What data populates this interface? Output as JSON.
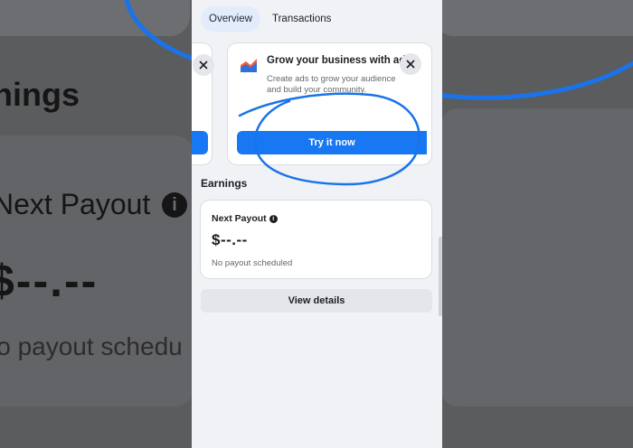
{
  "tabs": [
    {
      "label": "Overview",
      "active": true
    },
    {
      "label": "Transactions",
      "active": false
    }
  ],
  "promo": {
    "title": "Grow your business with ads",
    "description": "Create ads to grow your audience and build your community.",
    "cta_label": "Try it now",
    "close_icon": "close-icon"
  },
  "earnings": {
    "section_title": "Earnings",
    "next_payout_label": "Next Payout",
    "amount": "$--.--",
    "status": "No payout scheduled",
    "view_details_label": "View details"
  },
  "background_zoom": {
    "title_fragment": "nings",
    "payout_label": "Next Payout",
    "amount": "$--.--",
    "status_fragment": "lo payout schedu"
  },
  "colors": {
    "accent": "#1877f2",
    "annotation": "#1a73e8",
    "page_bg": "#f0f2f5"
  }
}
